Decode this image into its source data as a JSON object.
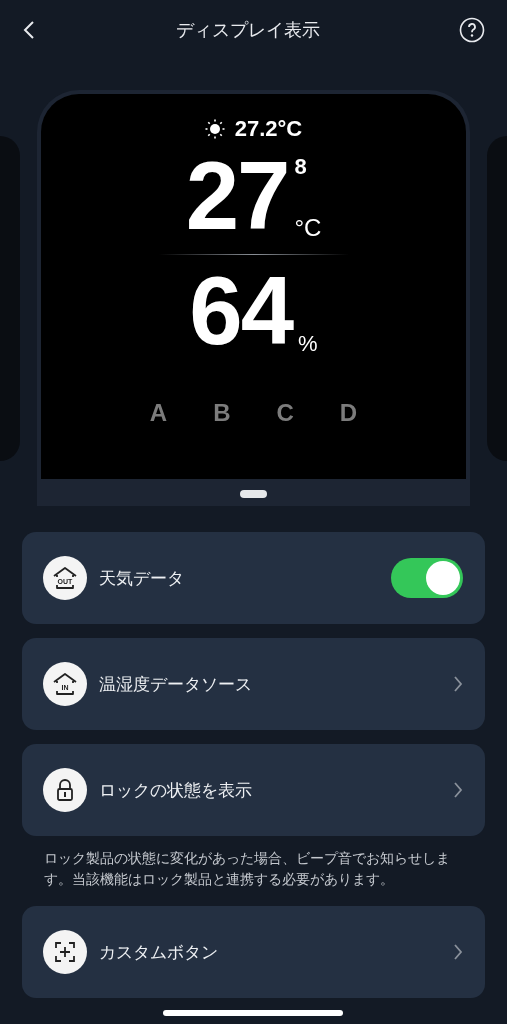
{
  "header": {
    "title": "ディスプレイ表示"
  },
  "preview": {
    "weather": "27.2°C",
    "temperature": "27",
    "temperature_decimal": "8",
    "temperature_unit": "°C",
    "humidity": "64",
    "humidity_unit": "%",
    "buttons": [
      "A",
      "B",
      "C",
      "D"
    ]
  },
  "settings": [
    {
      "kind": "toggle",
      "icon_label": "OUT",
      "label": "天気データ",
      "on": true
    },
    {
      "kind": "link",
      "icon_label": "IN",
      "label": "温湿度データソース"
    },
    {
      "kind": "link",
      "label": "ロックの状態を表示"
    },
    {
      "kind": "note",
      "label": "ロック製品の状態に変化があった場合、ビープ音でお知らせします。当該機能はロック製品と連携する必要があります。"
    },
    {
      "kind": "link",
      "label": "カスタムボタン"
    }
  ]
}
